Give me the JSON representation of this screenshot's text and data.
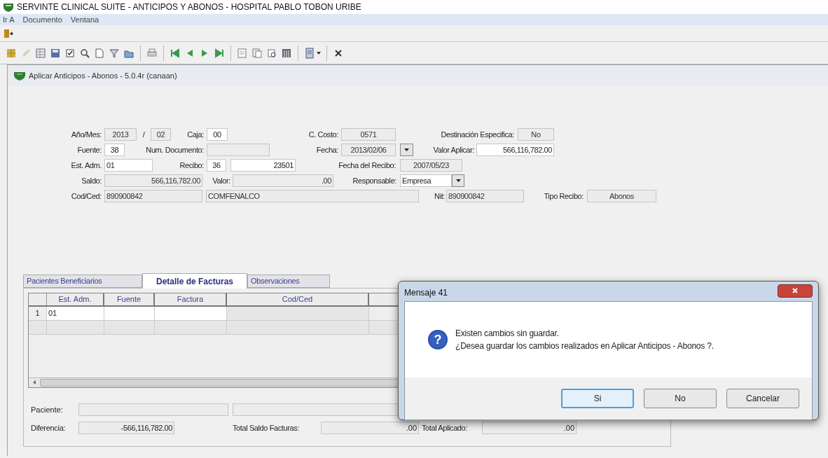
{
  "window": {
    "title": "SERVINTE CLINICAL SUITE - ANTICIPOS Y ABONOS  - HOSPITAL PABLO TOBON URIBE"
  },
  "menu": [
    "Ir A",
    "Documento",
    "Ventana"
  ],
  "child_window": {
    "title": "Aplicar Anticipos - Abonos -  5.0.4r (canaan)"
  },
  "form_rows": [
    [
      {
        "kind": "label",
        "text": "Año/Mes:"
      },
      {
        "kind": "field",
        "value": "2013",
        "editable": false
      },
      {
        "kind": "label",
        "text": "/"
      },
      {
        "kind": "field",
        "value": "02",
        "editable": false
      },
      {
        "kind": "label",
        "text": "Caja:"
      },
      {
        "kind": "field",
        "value": "00",
        "editable": true
      },
      {
        "kind": "label",
        "text": "C. Costo:"
      },
      {
        "kind": "field",
        "value": "0571",
        "editable": false
      },
      {
        "kind": "label",
        "text": "Destinación Especifica:"
      },
      {
        "kind": "field",
        "value": "No",
        "editable": false
      }
    ],
    [
      {
        "kind": "label",
        "text": "Fuente:"
      },
      {
        "kind": "field",
        "value": "38",
        "editable": true
      },
      {
        "kind": "label",
        "text": "Num. Documento:"
      },
      {
        "kind": "field",
        "editable": false
      },
      {
        "kind": "label",
        "text": "Fecha:"
      },
      {
        "kind": "field",
        "value": "2013/02/06",
        "editable": false
      },
      {
        "kind": "dropdown"
      },
      {
        "kind": "label",
        "text": "Valor Aplicar:"
      },
      {
        "kind": "field",
        "value": "566,116,782.00",
        "editable": true
      }
    ],
    [
      {
        "kind": "label",
        "text": "Est. Adm."
      },
      {
        "kind": "field",
        "value": "01",
        "editable": true
      },
      {
        "kind": "label",
        "text": "Recibo:"
      },
      {
        "kind": "field",
        "value": "36",
        "editable": true
      },
      {
        "kind": "field",
        "value": "23501",
        "editable": true
      },
      {
        "kind": "label",
        "text": "Fecha del Recibo:"
      },
      {
        "kind": "field",
        "value": "2007/05/23",
        "editable": false
      }
    ],
    [
      {
        "kind": "label",
        "text": "Saldo:"
      },
      {
        "kind": "field",
        "value": "566,116,782.00",
        "editable": false
      },
      {
        "kind": "label",
        "text": "Valor:"
      },
      {
        "kind": "field",
        "value": ".00",
        "editable": false
      },
      {
        "kind": "label",
        "text": "Responsable:"
      },
      {
        "kind": "field",
        "value": "Empresa",
        "editable": true
      },
      {
        "kind": "dropdown"
      }
    ],
    [
      {
        "kind": "label",
        "text": "Cod/Ced:"
      },
      {
        "kind": "field",
        "value": "890900842",
        "editable": false
      },
      {
        "kind": "field",
        "value": "COMFENALCO",
        "editable": false
      },
      {
        "kind": "label",
        "text": "Nit:"
      },
      {
        "kind": "field",
        "value": "890900842",
        "editable": false
      },
      {
        "kind": "label",
        "text": "Tipo Recibo:"
      },
      {
        "kind": "field",
        "value": "Abonos",
        "editable": false
      }
    ]
  ],
  "tabs": [
    {
      "label": "Pacientes Beneficiarios",
      "selected": false
    },
    {
      "label": "Detalle de Facturas",
      "selected": true
    },
    {
      "label": "Observaciones",
      "selected": false
    }
  ],
  "table": {
    "columns": [
      "Est. Adm.",
      "Fuente",
      "Factura",
      "Cod/Ced"
    ],
    "rows": [
      {
        "number": "1",
        "cells": [
          "01"
        ]
      }
    ]
  },
  "footer": {
    "paciente_label": "Paciente:",
    "diferencia_label": "Diferencia:",
    "diferencia": "-566,116,782.00",
    "total_saldo_label": "Total Saldo Facturas:",
    "total_saldo": ".00",
    "total_aplicado_label": "Total Aplicado:",
    "total_aplicado": ".00"
  },
  "dialog": {
    "title": "Mensaje 41",
    "icon_glyph": "?",
    "lines": [
      "Existen cambios sin guardar.",
      "¿Desea guardar los cambios realizados en Aplicar Anticipos - Abonos ?."
    ],
    "buttons": [
      {
        "label": "Si",
        "selected": true
      },
      {
        "label": "No",
        "selected": false
      },
      {
        "label": "Cancelar",
        "selected": false
      }
    ]
  }
}
